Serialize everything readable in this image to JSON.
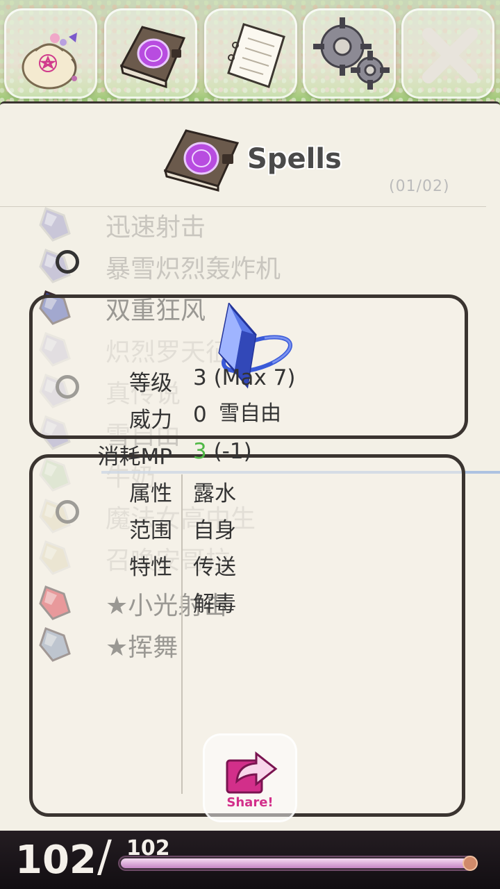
{
  "toolbar": {
    "buttons": [
      {
        "icon": "bag-icon"
      },
      {
        "icon": "spellbook-icon"
      },
      {
        "icon": "notebook-icon"
      },
      {
        "icon": "gear-icon"
      },
      {
        "icon": "close-icon"
      }
    ]
  },
  "header": {
    "title": "Spells",
    "page_counter": "(01/02)"
  },
  "spell_list": [
    {
      "name": "迅速射击",
      "style": "faded",
      "gem_color": "#c9c6d8",
      "marker": false
    },
    {
      "name": "暴雪炽烈轰炸机",
      "style": "faded",
      "gem_color": "#c9c6d8",
      "marker": true
    },
    {
      "name": "双重狂风",
      "style": "strong",
      "gem_color": "#3c4fb0",
      "marker": false
    },
    {
      "name": "炽烈罗天征",
      "style": "faded",
      "gem_color": "#c9c6d8",
      "marker": false
    },
    {
      "name": "真传说",
      "style": "faded",
      "gem_color": "#c9c6d8",
      "marker": true
    },
    {
      "name": "雪自由",
      "style": "faded",
      "gem_color": "#c9c6d8",
      "marker": false
    },
    {
      "name": "牛奶",
      "style": "faded",
      "gem_color": "#c3d8b8",
      "marker": false
    },
    {
      "name": "魔法女高中生",
      "style": "faded",
      "gem_color": "#ddd6b6",
      "marker": true
    },
    {
      "name": "召唤安哥拉",
      "style": "faded",
      "gem_color": "#ddd6b6",
      "marker": false
    },
    {
      "name": "★小光射击",
      "style": "strong",
      "gem_color": "#d82d3c",
      "marker": false
    },
    {
      "name": "★挥舞",
      "style": "strong",
      "gem_color": "#7a8fb0",
      "marker": false
    }
  ],
  "selected_spell": {
    "name": "雪自由",
    "icon": "crystal-icon"
  },
  "details": {
    "level_label": "等级",
    "level_value": "3 (Max 7)",
    "power_label": "威力",
    "power_value": "0",
    "mp_label": "消耗MP",
    "mp_current": "3",
    "mp_delta": " (-1)",
    "attribute_label": "属性",
    "attribute_value": "露水",
    "range_label": "范围",
    "range_value": "自身",
    "trait_label": "特性",
    "trait_values": [
      "传送",
      "解毒"
    ]
  },
  "share": {
    "label": "Share!",
    "icon": "share-arrow-icon"
  },
  "hp": {
    "current": "102",
    "slash": "/",
    "max": "102",
    "fill_fraction": 1.0
  },
  "colors": {
    "mp_current": "#4fb845",
    "share_accent": "#d22f8a",
    "hp_fill": "#e3b2e0"
  }
}
